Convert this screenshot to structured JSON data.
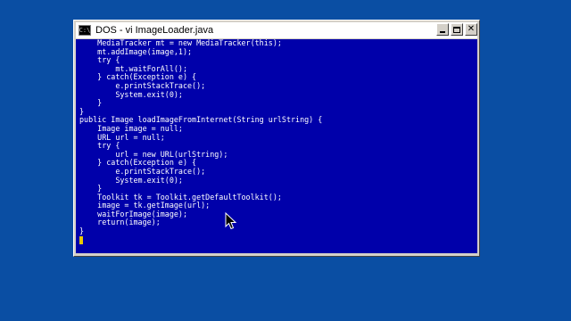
{
  "window": {
    "title": "DOS - vi ImageLoader.java",
    "icon": "console-icon",
    "icon_glyph": "C:\\",
    "buttons": {
      "minimize": "minimize-icon",
      "maximize": "maximize-icon",
      "close_label": "✕"
    }
  },
  "editor": {
    "lines": [
      "    MediaTracker mt = new MediaTracker(this);",
      "    mt.addImage(image,1);",
      "    try {",
      "        mt.waitForAll();",
      "    } catch(Exception e) {",
      "        e.printStackTrace();",
      "        System.exit(0);",
      "    }",
      "}",
      "public Image loadImageFromInternet(String urlString) {",
      "    Image image = null;",
      "    URL url = null;",
      "    try {",
      "        url = new URL(urlString);",
      "    } catch(Exception e) {",
      "        e.printStackTrace();",
      "        System.exit(0);",
      "    }",
      "    Toolkit tk = Toolkit.getDefaultToolkit();",
      "    image = tk.getImage(url);",
      "    waitForImage(image);",
      "    return(image);",
      "}"
    ],
    "cursor_color": "#e8c800",
    "background_color": "#0000aa",
    "text_color": "#ffffff"
  },
  "colors": {
    "desktop": "#0a4ea3",
    "window_frame": "#d4d0c8"
  }
}
